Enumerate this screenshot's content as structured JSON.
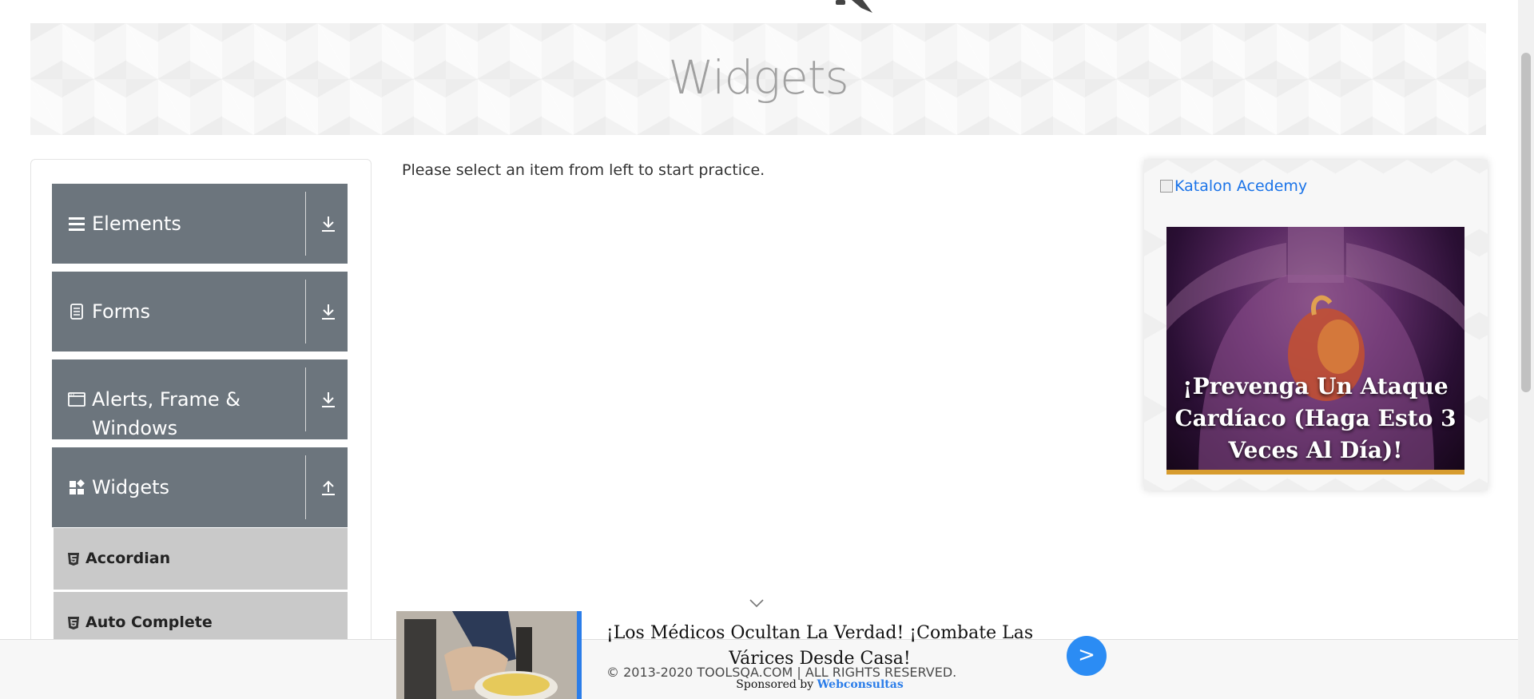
{
  "header": {
    "title": "Widgets"
  },
  "sidebar": {
    "groups": [
      {
        "label": "Elements",
        "icon": "hamburger-icon",
        "toggle_icon": "download-arrow-icon",
        "expanded": false
      },
      {
        "label": "Forms",
        "icon": "document-icon",
        "toggle_icon": "download-arrow-icon",
        "expanded": false
      },
      {
        "label": "Alerts, Frame & Windows",
        "icon": "window-icon",
        "toggle_icon": "download-arrow-icon",
        "expanded": false
      },
      {
        "label": "Widgets",
        "icon": "widgets-icon",
        "toggle_icon": "upload-arrow-icon",
        "expanded": true
      }
    ],
    "items": [
      {
        "label": "Accordian",
        "icon": "html5-icon"
      },
      {
        "label": "Auto Complete",
        "icon": "html5-icon"
      }
    ]
  },
  "main": {
    "message": "Please select an item from left to start practice."
  },
  "side_ad": {
    "image_alt": "Katalon Acedemy",
    "headline": "¡Prevenga Un Ataque Cardíaco (Haga Esto 3 Veces Al Día)!"
  },
  "bottom_ad": {
    "headline": "¡Los Médicos Ocultan La Verdad! ¡Combate Las Várices Desde Casa!",
    "sponsor_prefix": "Sponsored by",
    "sponsor_name": "Webconsultas",
    "go_label": ">"
  },
  "footer": {
    "copyright": "© 2013-2020 TOOLSQA.COM | ALL RIGHTS RESERVED."
  },
  "colors": {
    "nav_group_bg": "#6c757d",
    "nav_item_bg": "#c9c9c9",
    "link": "#1a73e8",
    "accent_blue": "#2b8cf4",
    "ad_stripe": "#d79c2f"
  }
}
